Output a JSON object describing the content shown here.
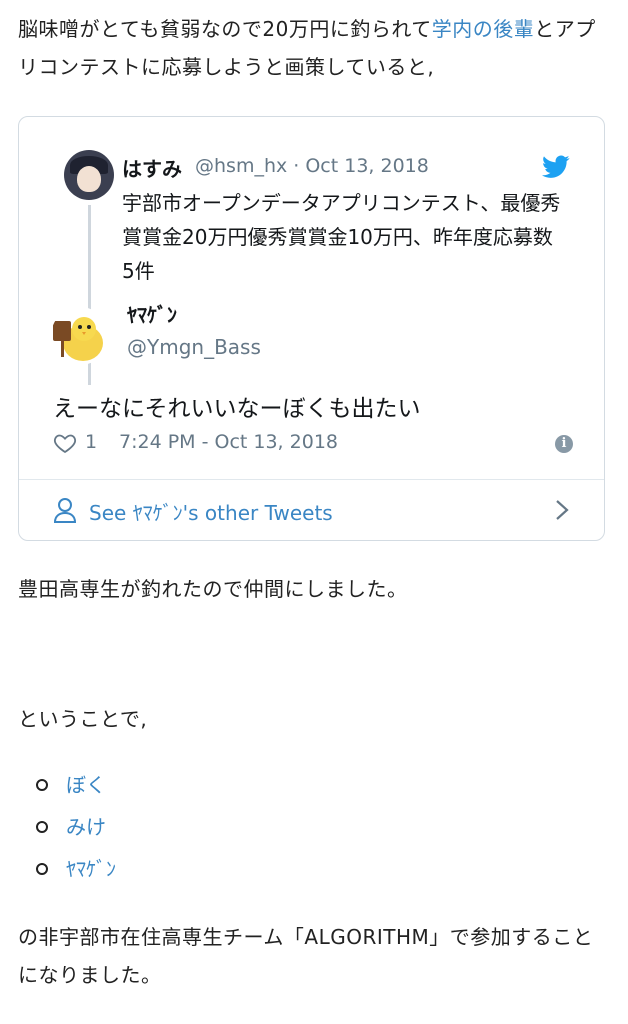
{
  "intro": {
    "text_before": "脳味噌がとても貧弱なので20万円に釣られて",
    "link": "学内の後輩",
    "text_after": "とアプリコンテストに応募しようと画策していると,"
  },
  "embedded_tweet": {
    "quoted": {
      "name": "はすみ",
      "meta": "@hsm_hx · Oct 13, 2018",
      "text": "宇部市オープンデータアプリコンテスト、最優秀賞賞金20万円優秀賞賞金10万円、昨年度応募数5件"
    },
    "reply": {
      "name": "ﾔﾏｹﾞﾝ",
      "handle": "@Ymgn_Bass",
      "text": "えーなにそれいいなーぼくも出たい",
      "likes": "1",
      "timestamp": "7:24 PM - Oct 13, 2018"
    },
    "see_more": "See ﾔﾏｹﾞﾝ's other Tweets",
    "icons": [
      "bird-icon",
      "heart-icon",
      "info-icon",
      "person-icon",
      "chevron-right-icon"
    ],
    "accent_color": "#1da1f2"
  },
  "paragraph2": "豊田高専生が釣れたので仲間にしました。",
  "paragraph3": "ということで,",
  "members": [
    "ぼく",
    "みけ",
    "ﾔﾏｹﾞﾝ"
  ],
  "paragraph4": "の非宇部市在住高専生チーム「ALGORITHM」で参加することになりました。",
  "link_color": "#3a86c4"
}
